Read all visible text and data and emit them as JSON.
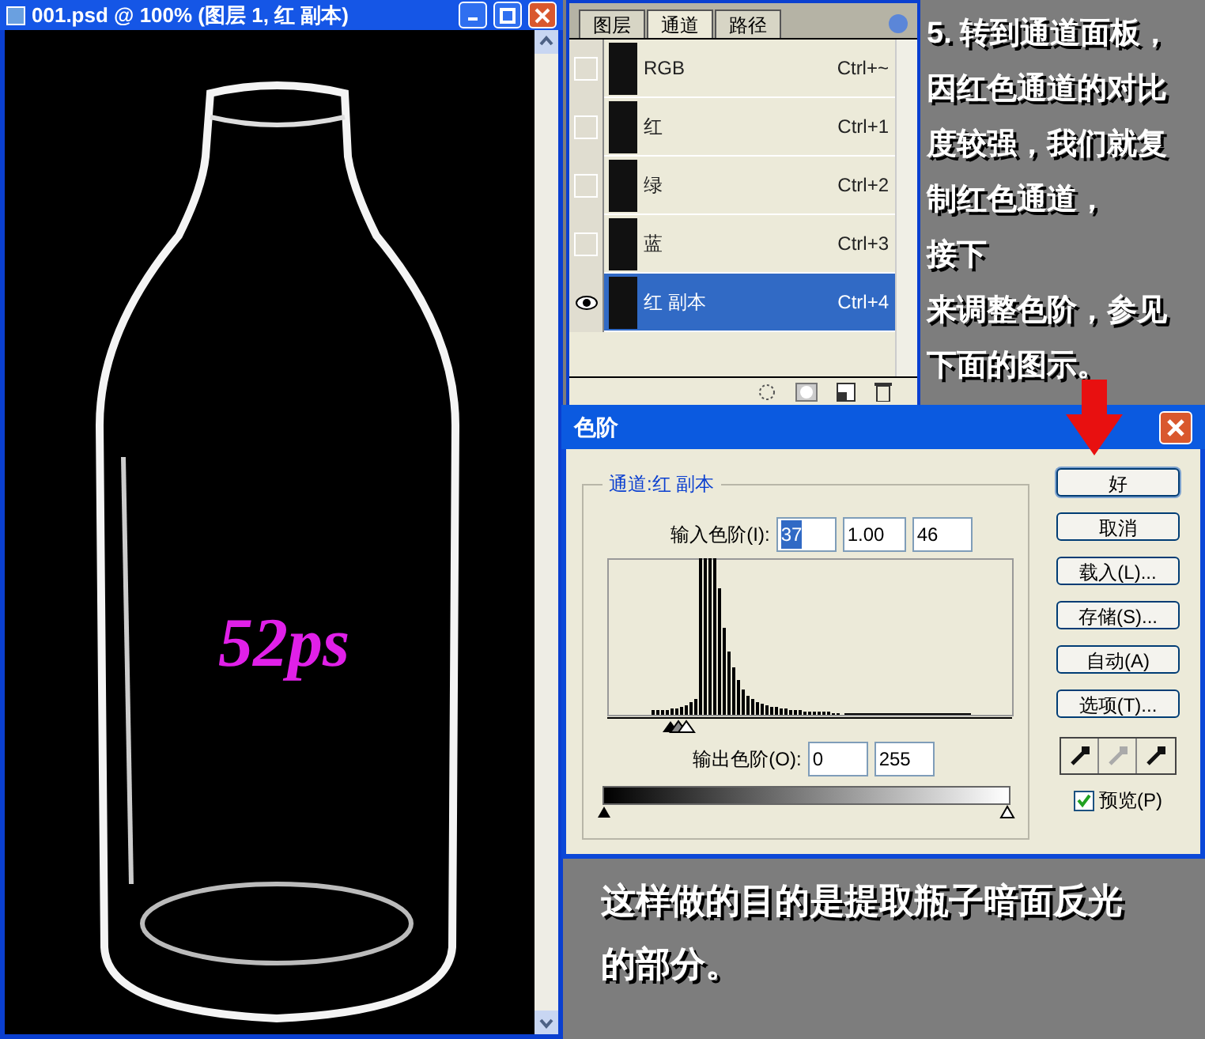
{
  "document": {
    "title": "001.psd @ 100% (图层 1, 红 副本)",
    "overlay_text": "52ps"
  },
  "channels_panel": {
    "tabs": [
      {
        "label": "图层",
        "selected": false
      },
      {
        "label": "通道",
        "selected": true
      },
      {
        "label": "路径",
        "selected": false
      }
    ],
    "rows": [
      {
        "name": "RGB",
        "shortcut": "Ctrl+~",
        "visible": false,
        "selected": false
      },
      {
        "name": "红",
        "shortcut": "Ctrl+1",
        "visible": false,
        "selected": false
      },
      {
        "name": "绿",
        "shortcut": "Ctrl+2",
        "visible": false,
        "selected": false
      },
      {
        "name": "蓝",
        "shortcut": "Ctrl+3",
        "visible": false,
        "selected": false
      },
      {
        "name": "红 副本",
        "shortcut": "Ctrl+4",
        "visible": true,
        "selected": true
      }
    ]
  },
  "instruction": [
    "5. 转到通道面板，",
    "因红色通道的对比",
    "度较强，我们就复",
    "制红色通道，",
    "接下",
    "来调整色阶，参见",
    "下面的图示。"
  ],
  "levels_dialog": {
    "title": "色阶",
    "channel_label": "通道:红 副本",
    "input_label": "输入色阶(I):",
    "input_values": [
      {
        "value": "37",
        "selected": true
      },
      {
        "value": "1.00",
        "selected": false
      },
      {
        "value": "46",
        "selected": false
      }
    ],
    "output_label": "输出色阶(O):",
    "output_values": [
      "0",
      "255"
    ],
    "buttons": [
      "好",
      "取消",
      "载入(L)...",
      "存储(S)...",
      "自动(A)",
      "选项(T)..."
    ],
    "preview": {
      "label": "预览(P)",
      "checked": true
    }
  },
  "note": "这样做的目的是提取瓶子暗面反光的部分。"
}
